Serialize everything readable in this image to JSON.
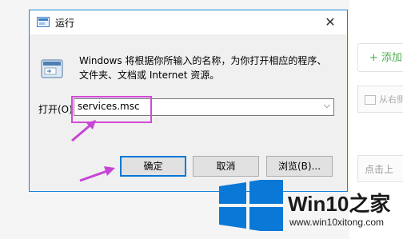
{
  "background": {
    "add_button": "+ 添加",
    "upload_label": "从右侧",
    "click_hint": "点击上"
  },
  "dialog": {
    "title": "运行",
    "close_symbol": "✕",
    "description_line1": "Windows 将根据你所输入的名称，为你打开相应的程序、",
    "description_line2": "文件夹、文档或 Internet 资源。",
    "open_label": "打开(O):",
    "open_value": "services.msc",
    "dropdown_symbol": "⌵",
    "buttons": {
      "ok": "确定",
      "cancel": "取消",
      "browse": "浏览(B)..."
    }
  },
  "watermark": {
    "brand_prefix": "Win10",
    "brand_suffix": "之家",
    "url": "www.win10xitong.com"
  },
  "colors": {
    "dialog_border": "#1883d7",
    "highlight": "#d34ad6",
    "arrow": "#c744d4",
    "win_logo": "#0a78d7"
  }
}
